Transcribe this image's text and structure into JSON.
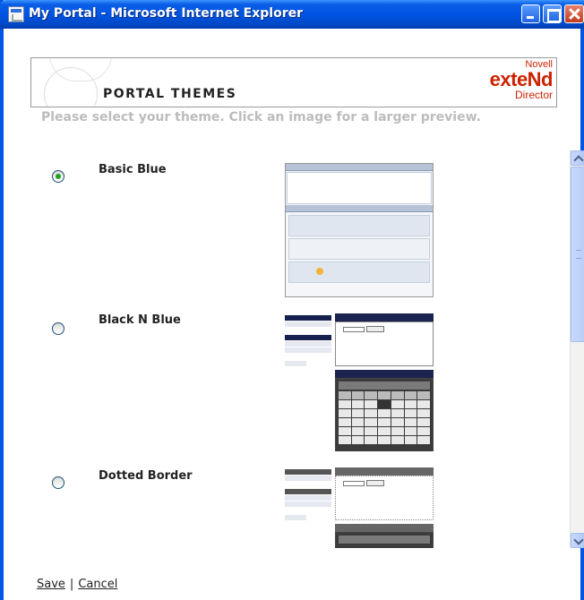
{
  "window": {
    "title": "My Portal - Microsoft Internet Explorer"
  },
  "header": {
    "heading": "PORTAL THEMES",
    "logo_novell": "Novell",
    "logo_extend": "exteNd",
    "logo_director": "Director"
  },
  "instruction": "Please select your theme. Click an image for a larger preview.",
  "themes": [
    {
      "label": "Basic Blue",
      "selected": true
    },
    {
      "label": "Black N Blue",
      "selected": false
    },
    {
      "label": "Dotted Border",
      "selected": false
    }
  ],
  "footer": {
    "save": "Save",
    "separator": "|",
    "cancel": "Cancel"
  },
  "colors": {
    "titlebar": "#0054e3",
    "logo": "#cc2200",
    "instruction": "#bcbcbc",
    "radio_checked": "#21a121"
  }
}
